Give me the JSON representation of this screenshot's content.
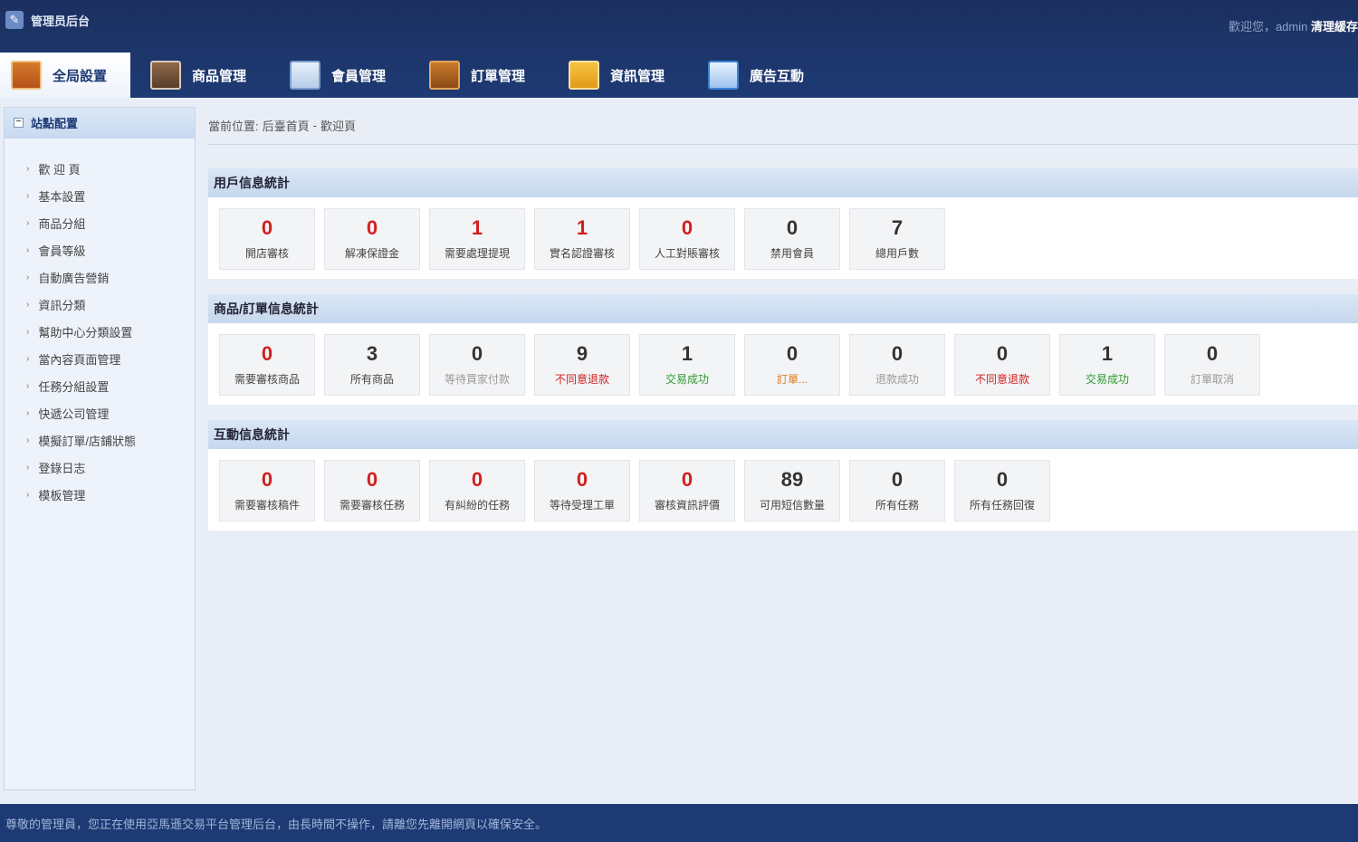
{
  "header": {
    "title": "管理员后台",
    "welcome": "歡迎您，admin",
    "clear_cache": "清理緩存"
  },
  "nav": [
    {
      "label": "全局設置",
      "icon": "settings-icon",
      "active": true
    },
    {
      "label": "商品管理",
      "icon": "goods-icon",
      "active": false
    },
    {
      "label": "會員管理",
      "icon": "member-icon",
      "active": false
    },
    {
      "label": "訂單管理",
      "icon": "order-icon",
      "active": false
    },
    {
      "label": "資訊管理",
      "icon": "news-icon",
      "active": false
    },
    {
      "label": "廣告互動",
      "icon": "ad-icon",
      "active": false
    }
  ],
  "sidebar": {
    "heading": "站點配置",
    "items": [
      {
        "label": "歡 迎 頁"
      },
      {
        "label": "基本設置"
      },
      {
        "label": "商品分組"
      },
      {
        "label": "會員等級"
      },
      {
        "label": "自動廣告營銷"
      },
      {
        "label": "資訊分類"
      },
      {
        "label": "幫助中心分類設置"
      },
      {
        "label": "當內容頁面管理"
      },
      {
        "label": "任務分組設置"
      },
      {
        "label": "快遞公司管理"
      },
      {
        "label": "模擬訂單/店鋪狀態"
      },
      {
        "label": "登錄日志"
      },
      {
        "label": "模板管理"
      }
    ]
  },
  "breadcrumb": {
    "prefix": "當前位置:",
    "home": "后臺首頁",
    "sep": "-",
    "current": "歡迎頁"
  },
  "sections": [
    {
      "title": "用戶信息統計",
      "cards": [
        {
          "value": "0",
          "label": "開店審核",
          "num_color": "red"
        },
        {
          "value": "0",
          "label": "解凍保證金",
          "num_color": "red"
        },
        {
          "value": "1",
          "label": "需要處理提現",
          "num_color": "red"
        },
        {
          "value": "1",
          "label": "實名認證審核",
          "num_color": "red"
        },
        {
          "value": "0",
          "label": "人工對賬審核",
          "num_color": "red"
        },
        {
          "value": "0",
          "label": "禁用會員",
          "num_color": "dark"
        },
        {
          "value": "7",
          "label": "總用戶數",
          "num_color": "dark"
        }
      ]
    },
    {
      "title": "商品/訂單信息統計",
      "cards": [
        {
          "value": "0",
          "label": "需要審核商品",
          "num_color": "red",
          "label_color": "default"
        },
        {
          "value": "3",
          "label": "所有商品",
          "num_color": "dark",
          "label_color": "default"
        },
        {
          "value": "0",
          "label": "等待買家付款",
          "num_color": "dark",
          "label_color": "gray"
        },
        {
          "value": "9",
          "label": "不同意退款",
          "num_color": "dark",
          "label_color": "red"
        },
        {
          "value": "1",
          "label": "交易成功",
          "num_color": "dark",
          "label_color": "green"
        },
        {
          "value": "0",
          "label": "訂單...",
          "num_color": "dark",
          "label_color": "orange"
        },
        {
          "value": "0",
          "label": "退款成功",
          "num_color": "dark",
          "label_color": "gray"
        },
        {
          "value": "0",
          "label": "不同意退款",
          "num_color": "dark",
          "label_color": "red"
        },
        {
          "value": "1",
          "label": "交易成功",
          "num_color": "dark",
          "label_color": "green"
        },
        {
          "value": "0",
          "label": "訂單取消",
          "num_color": "dark",
          "label_color": "gray"
        }
      ]
    },
    {
      "title": "互動信息統計",
      "cards": [
        {
          "value": "0",
          "label": "需要審核稿件",
          "num_color": "red"
        },
        {
          "value": "0",
          "label": "需要審核任務",
          "num_color": "red"
        },
        {
          "value": "0",
          "label": "有糾紛的任務",
          "num_color": "red"
        },
        {
          "value": "0",
          "label": "等待受理工單",
          "num_color": "red"
        },
        {
          "value": "0",
          "label": "審核資訊評價",
          "num_color": "red"
        },
        {
          "value": "89",
          "label": "可用短信數量",
          "num_color": "dark"
        },
        {
          "value": "0",
          "label": "所有任務",
          "num_color": "dark"
        },
        {
          "value": "0",
          "label": "所有任務回復",
          "num_color": "dark"
        }
      ]
    }
  ],
  "footer": {
    "text": "尊敬的管理員，您正在使用亞馬遜交易平台管理后台，由長時間不操作，請離您先離開網頁以確保安全。"
  },
  "colors": {
    "header_bg": "#1e3a74",
    "accent_red": "#d11f1f",
    "accent_green": "#2f9a2f"
  }
}
